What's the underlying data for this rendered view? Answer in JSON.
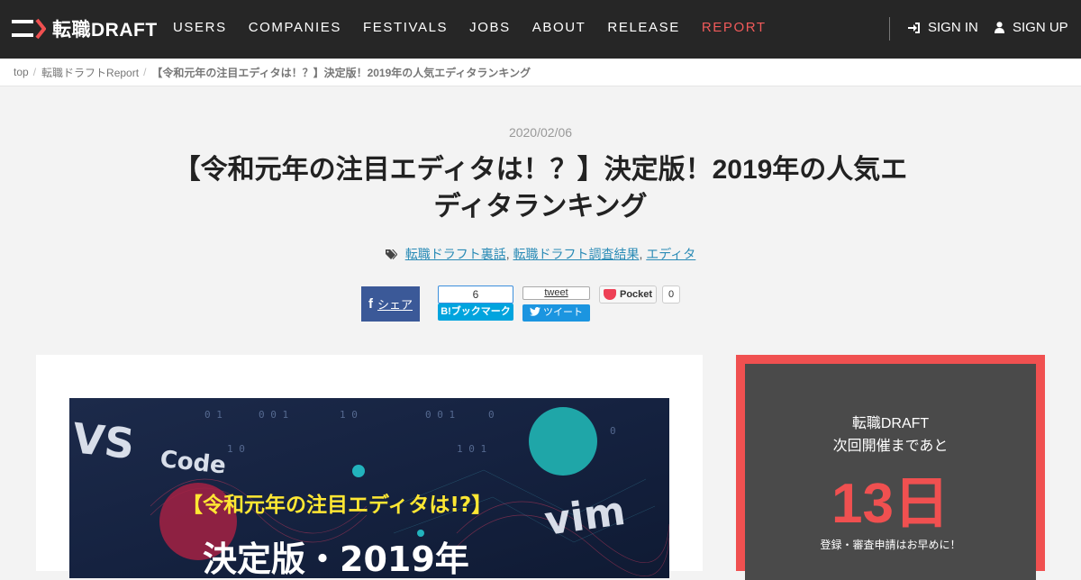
{
  "header": {
    "logo_text": "転職DRAFT",
    "nav": [
      {
        "label": "USERS",
        "active": false
      },
      {
        "label": "COMPANIES",
        "active": false
      },
      {
        "label": "FESTIVALS",
        "active": false
      },
      {
        "label": "JOBS",
        "active": false
      },
      {
        "label": "ABOUT",
        "active": false
      },
      {
        "label": "RELEASE",
        "active": false
      },
      {
        "label": "REPORT",
        "active": true
      }
    ],
    "sign_in": "SIGN IN",
    "sign_up": "SIGN UP"
  },
  "breadcrumb": {
    "items": [
      "top",
      "転職ドラフトReport"
    ],
    "current": "【令和元年の注目エディタは！？】決定版！2019年の人気エディタランキング"
  },
  "article": {
    "date": "2020/02/06",
    "title": "【令和元年の注目エディタは！？】決定版！2019年の人気エディタランキング",
    "tags": [
      "転職ドラフト裏話",
      "転職ドラフト調査結果",
      "エディタ"
    ]
  },
  "share": {
    "facebook_label": "シェア",
    "hatena_count": "6",
    "hatena_label": "ブックマーク",
    "tweet_count_label": "tweet",
    "tweet_label": "ツイート",
    "pocket_label": "Pocket",
    "pocket_count": "0"
  },
  "hero": {
    "text_vscode_1": "VS",
    "text_vscode_2": "Code",
    "text_vim": "vim",
    "headline_1": "【令和元年の注目エディタは!?】",
    "headline_2": "決定版・2019年"
  },
  "sidebar": {
    "line1": "転職DRAFT",
    "line2": "次回開催まであと",
    "countdown": "13日",
    "note": "登録・審査申請はお早めに！"
  },
  "colors": {
    "header_bg": "#262626",
    "accent": "#f05050",
    "link": "#2a8bb6"
  }
}
